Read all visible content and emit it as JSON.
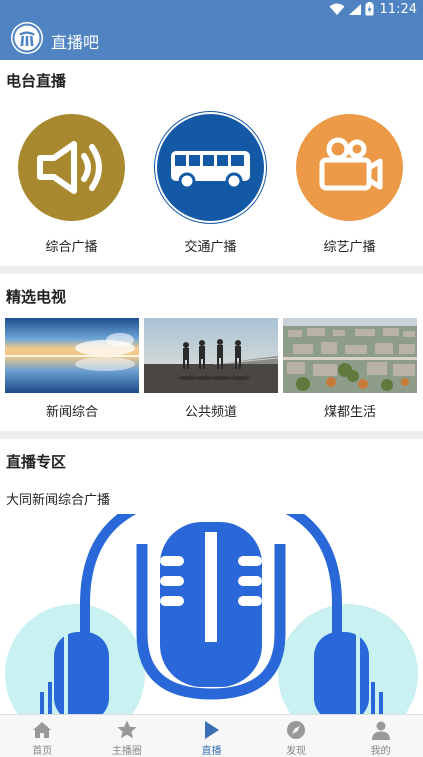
{
  "status_bar": {
    "time": "11:24",
    "icons": [
      "wifi-icon",
      "signal-icon",
      "battery-icon"
    ]
  },
  "app_bar": {
    "title": "直播吧",
    "logo": "app-logo"
  },
  "radio_section": {
    "title": "电台直播",
    "items": [
      {
        "label": "综合广播",
        "icon": "speaker-icon",
        "color": "#a9892f"
      },
      {
        "label": "交通广播",
        "icon": "bus-icon",
        "color": "#1459a6"
      },
      {
        "label": "综艺广播",
        "icon": "video-camera-icon",
        "color": "#ec9a48"
      }
    ]
  },
  "tv_section": {
    "title": "精选电视",
    "items": [
      {
        "label": "新闻综合",
        "image": "sunset-lake-thumbnail"
      },
      {
        "label": "公共频道",
        "image": "runners-thumbnail"
      },
      {
        "label": "煤都生活",
        "image": "city-aerial-thumbnail"
      }
    ]
  },
  "live_section": {
    "title": "直播专区",
    "item_name": "大同新闻综合广播",
    "image": "microphone-headphones-banner"
  },
  "bottom_nav": {
    "items": [
      {
        "label": "首页",
        "icon": "home-icon",
        "active": false
      },
      {
        "label": "主播圈",
        "icon": "star-icon",
        "active": false
      },
      {
        "label": "直播",
        "icon": "play-icon",
        "active": true
      },
      {
        "label": "发现",
        "icon": "compass-icon",
        "active": false
      },
      {
        "label": "我的",
        "icon": "person-icon",
        "active": false
      }
    ]
  },
  "colors": {
    "primary": "#4f83c2",
    "nav_active": "#3b6fb5",
    "nav_inactive": "#888888",
    "divider": "#eeeeee"
  }
}
